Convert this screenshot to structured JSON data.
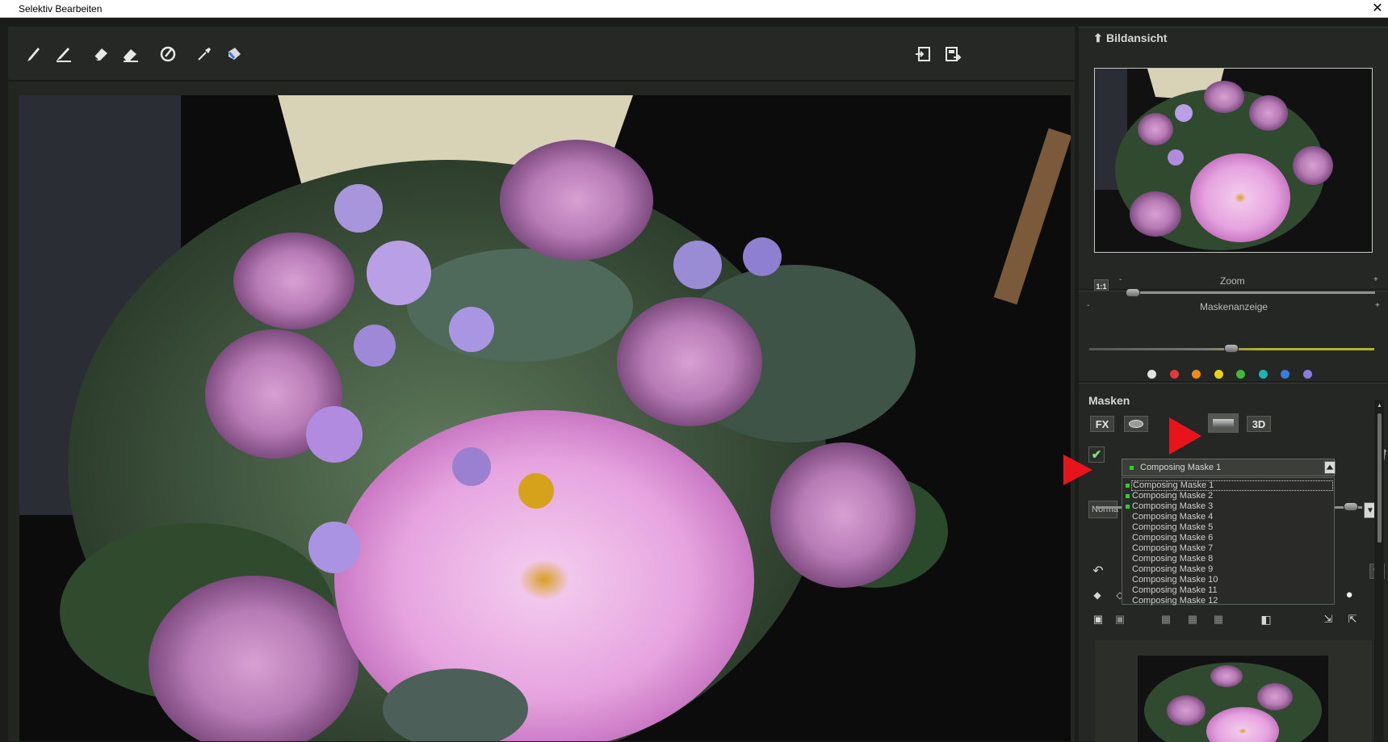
{
  "window": {
    "title": "Selektiv Bearbeiten",
    "close_label": "✕"
  },
  "toolbar": {
    "tools": [
      {
        "name": "brush-icon"
      },
      {
        "name": "brush-plus-icon"
      },
      {
        "name": "eraser-icon"
      },
      {
        "name": "eraser-soft-icon"
      },
      {
        "name": "smart-brush-icon"
      },
      {
        "name": "pipette-icon"
      },
      {
        "name": "fill-icon"
      }
    ],
    "right_tools": [
      {
        "name": "import-icon"
      },
      {
        "name": "export-icon"
      }
    ]
  },
  "bildansicht": {
    "title": "Bildansicht",
    "arrow": "⬆"
  },
  "zoom": {
    "label": "Zoom",
    "one_to_one": "1:1",
    "minus": "-",
    "plus": "+",
    "value": 0.02
  },
  "maskenanzeige": {
    "label": "Maskenanzeige",
    "minus": "-",
    "plus": "+",
    "value": 0.5,
    "color_dots": [
      "#e2e2e2",
      "#e23a3a",
      "#f08a1e",
      "#e8d21a",
      "#3dbb3d",
      "#1cb5b5",
      "#3b7be0",
      "#8a7be0"
    ]
  },
  "masken": {
    "title": "Masken",
    "buttons": {
      "fx": "FX",
      "threed": "3D"
    },
    "selected": "Composing Maske 1",
    "items": [
      {
        "label": "Composing Maske 1",
        "active": true
      },
      {
        "label": "Composing Maske 2",
        "active": true
      },
      {
        "label": "Composing Maske 3",
        "active": true
      },
      {
        "label": "Composing Maske 4",
        "active": false
      },
      {
        "label": "Composing Maske 5",
        "active": false
      },
      {
        "label": "Composing Maske 6",
        "active": false
      },
      {
        "label": "Composing Maske 7",
        "active": false
      },
      {
        "label": "Composing Maske 8",
        "active": false
      },
      {
        "label": "Composing Maske 9",
        "active": false
      },
      {
        "label": "Composing Maske 10",
        "active": false
      },
      {
        "label": "Composing Maske 11",
        "active": false
      },
      {
        "label": "Composing Maske 12",
        "active": false
      }
    ],
    "blend_prefix": "Norma",
    "slider_minus": "-",
    "slider_plus": "+"
  },
  "colors": {
    "accent_arrow": "#e8141c",
    "indicator_green": "#27d327"
  }
}
